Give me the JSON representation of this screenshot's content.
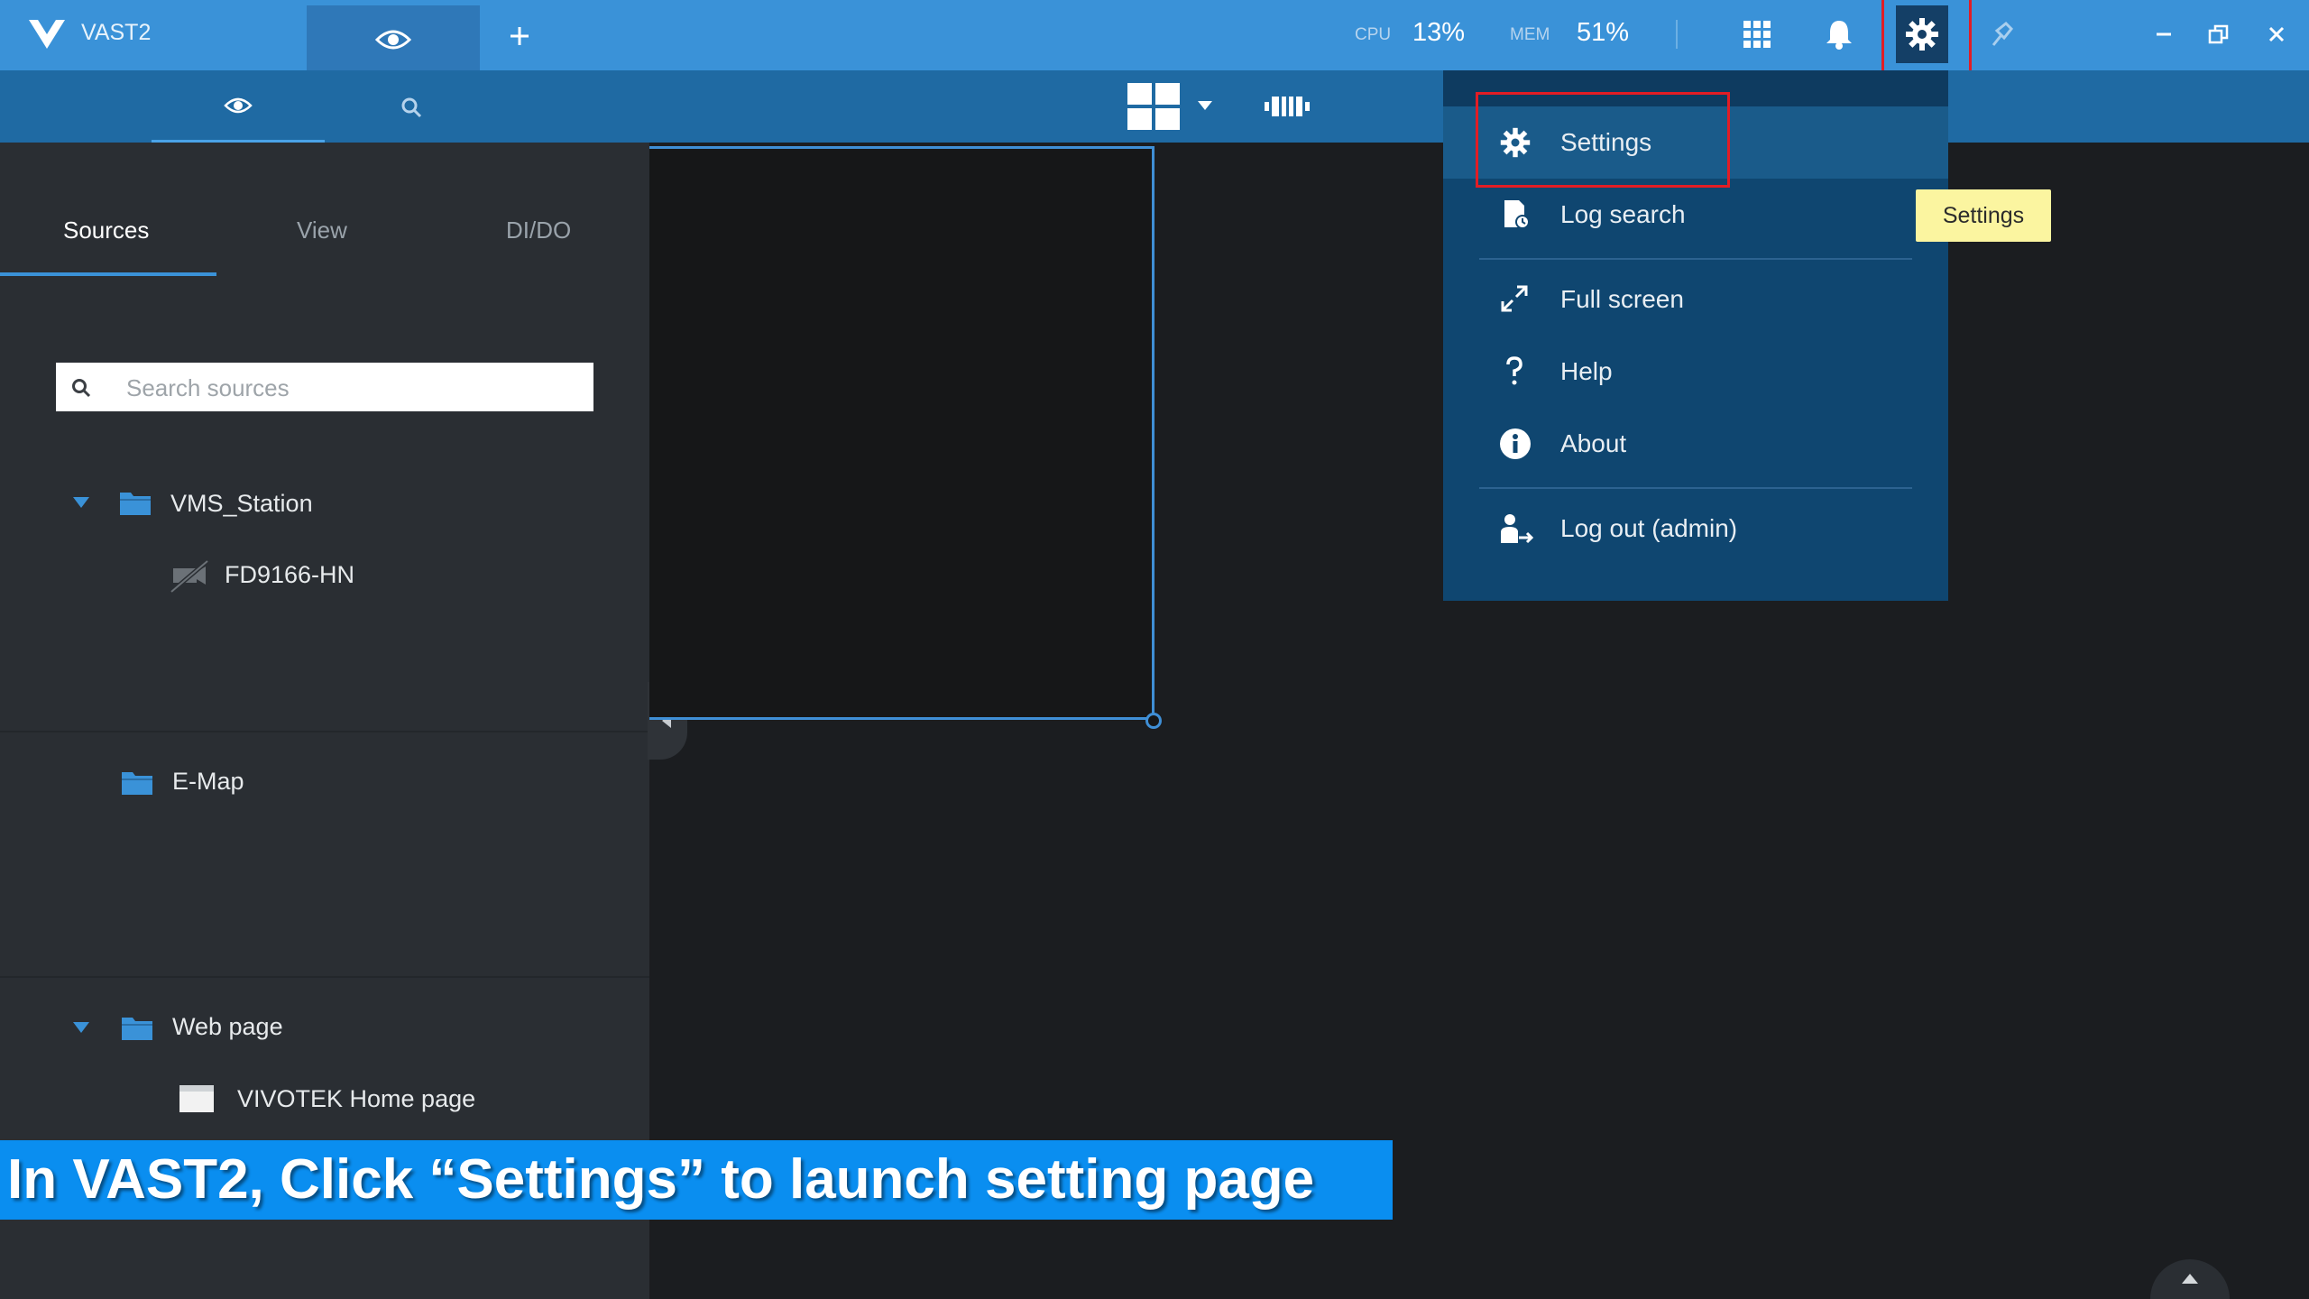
{
  "titlebar": {
    "app_name": "VAST2",
    "cpu_label": "CPU",
    "cpu_value": "13%",
    "mem_label": "MEM",
    "mem_value": "51%",
    "icons": [
      "live-view-icon",
      "plus-icon",
      "grid-apps-icon",
      "bell-icon",
      "gear-icon",
      "pin-icon",
      "minimize-icon",
      "restore-icon",
      "close-icon"
    ]
  },
  "toolbar": {
    "icons": [
      "eye-icon",
      "search-icon",
      "layout-grid-icon",
      "chevron-down-icon",
      "filmstrip-icon"
    ]
  },
  "leftpanel": {
    "tabs": [
      {
        "label": "Sources"
      },
      {
        "label": "View"
      },
      {
        "label": "DI/DO"
      }
    ],
    "search_placeholder": "Search sources",
    "tree": {
      "station": "VMS_Station",
      "camera": "FD9166-HN",
      "emap": "E-Map",
      "webpage_group": "Web page",
      "webpage_item": "VIVOTEK Home page"
    }
  },
  "menu": {
    "items": [
      {
        "label": "Settings",
        "icon": "gear-icon"
      },
      {
        "label": "Log search",
        "icon": "log-search-icon"
      },
      {
        "label": "Full screen",
        "icon": "fullscreen-icon"
      },
      {
        "label": "Help",
        "icon": "help-icon"
      },
      {
        "label": "About",
        "icon": "info-icon"
      },
      {
        "label": "Log out (admin)",
        "icon": "logout-icon"
      }
    ]
  },
  "tooltip": "Settings",
  "caption": "In VAST2, Click “Settings” to launch setting page",
  "colors": {
    "titlebar": "#3a92d8",
    "toolbar": "#1f6aa3",
    "menu": "#0f4670",
    "highlight": "#e21d25",
    "caption_bg": "#0a8ef0",
    "tooltip_bg": "#fbf5a0"
  }
}
